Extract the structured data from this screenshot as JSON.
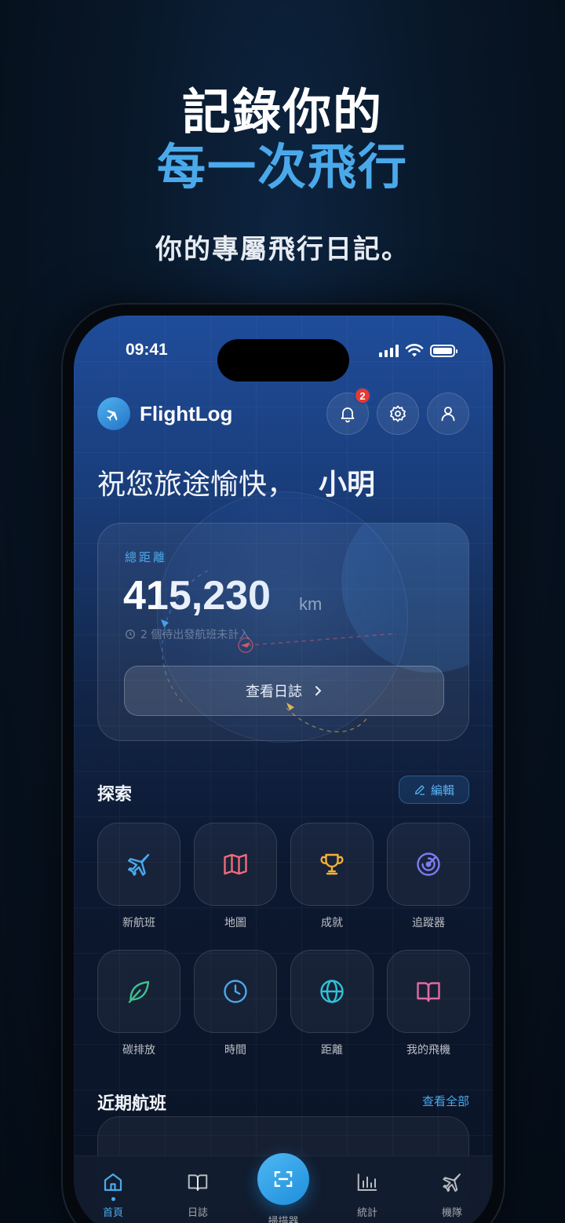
{
  "promo": {
    "line1": "記錄你的",
    "line2": "每一次飛行",
    "subtitle": "你的專屬飛行日記。"
  },
  "status_bar": {
    "time": "09:41"
  },
  "header": {
    "app_name": "FlightLog",
    "notification_count": "2"
  },
  "greeting": {
    "text": "祝您旅途愉快，",
    "name": "小明"
  },
  "summary_card": {
    "label": "總距離",
    "distance": "415,230",
    "unit": "km",
    "pending_note": "2 個待出發航班未計入",
    "button_label": "查看日誌"
  },
  "explore": {
    "title": "探索",
    "edit_label": "編輯",
    "tiles": [
      {
        "label": "新航班",
        "icon": "plane-icon",
        "color": "#4aa9ea"
      },
      {
        "label": "地圖",
        "icon": "map-icon",
        "color": "#ef6b7a"
      },
      {
        "label": "成就",
        "icon": "trophy-icon",
        "color": "#f2b233"
      },
      {
        "label": "追蹤器",
        "icon": "radar-icon",
        "color": "#7c7cf0"
      },
      {
        "label": "碳排放",
        "icon": "leaf-icon",
        "color": "#3ec28f"
      },
      {
        "label": "時間",
        "icon": "clock-icon",
        "color": "#4aa9ea"
      },
      {
        "label": "距離",
        "icon": "globe-icon",
        "color": "#2fc2d6"
      },
      {
        "label": "我的飛機",
        "icon": "book-icon",
        "color": "#e26aa6"
      }
    ]
  },
  "recent": {
    "title": "近期航班",
    "view_all": "查看全部"
  },
  "tab_bar": {
    "tabs": [
      {
        "label": "首頁",
        "icon": "home-icon"
      },
      {
        "label": "日誌",
        "icon": "book-icon"
      },
      {
        "label": "掃描器",
        "icon": "scan-icon"
      },
      {
        "label": "統計",
        "icon": "bar-chart-icon"
      },
      {
        "label": "機隊",
        "icon": "plane-icon"
      }
    ]
  },
  "colors": {
    "accent": "#4aa9ea",
    "badge": "#e53935"
  }
}
